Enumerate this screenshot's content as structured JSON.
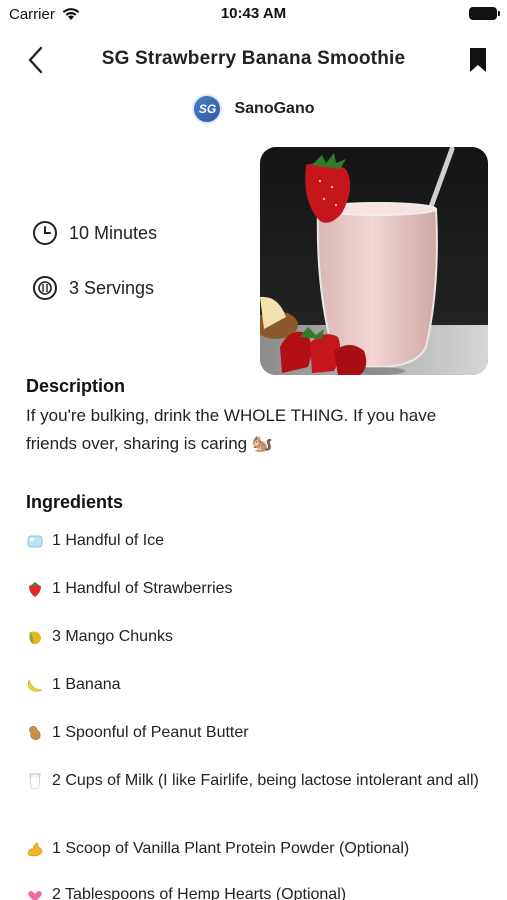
{
  "status_bar": {
    "carrier": "Carrier",
    "time": "10:43 AM"
  },
  "header": {
    "title": "SG Strawberry Banana Smoothie"
  },
  "author": {
    "initials": "SG",
    "name": "SanoGano"
  },
  "meta": {
    "time": "10 Minutes",
    "servings": "3 Servings"
  },
  "description": {
    "title": "Description",
    "text": "If you're bulking, drink the WHOLE THING. If you have friends over, sharing is caring 🐿️"
  },
  "ingredients": {
    "title": "Ingredients",
    "items": [
      {
        "icon": "ice-cube-icon",
        "text": "1 Handful of Ice"
      },
      {
        "icon": "strawberry-icon",
        "text": "1 Handful of Strawberries"
      },
      {
        "icon": "mango-icon",
        "text": "3 Mango Chunks"
      },
      {
        "icon": "banana-icon",
        "text": "1 Banana"
      },
      {
        "icon": "peanut-icon",
        "text": "1 Spoonful of Peanut Butter"
      },
      {
        "icon": "milk-glass-icon",
        "text": "2 Cups of Milk (I like Fairlife, being lactose intolerant and all)"
      },
      {
        "icon": "flexed-biceps-icon",
        "text": "1 Scoop of Vanilla Plant Protein Powder (Optional)"
      },
      {
        "icon": "hearts-icon",
        "text": "2 Tablespoons of Hemp Hearts (Optional)"
      }
    ]
  }
}
